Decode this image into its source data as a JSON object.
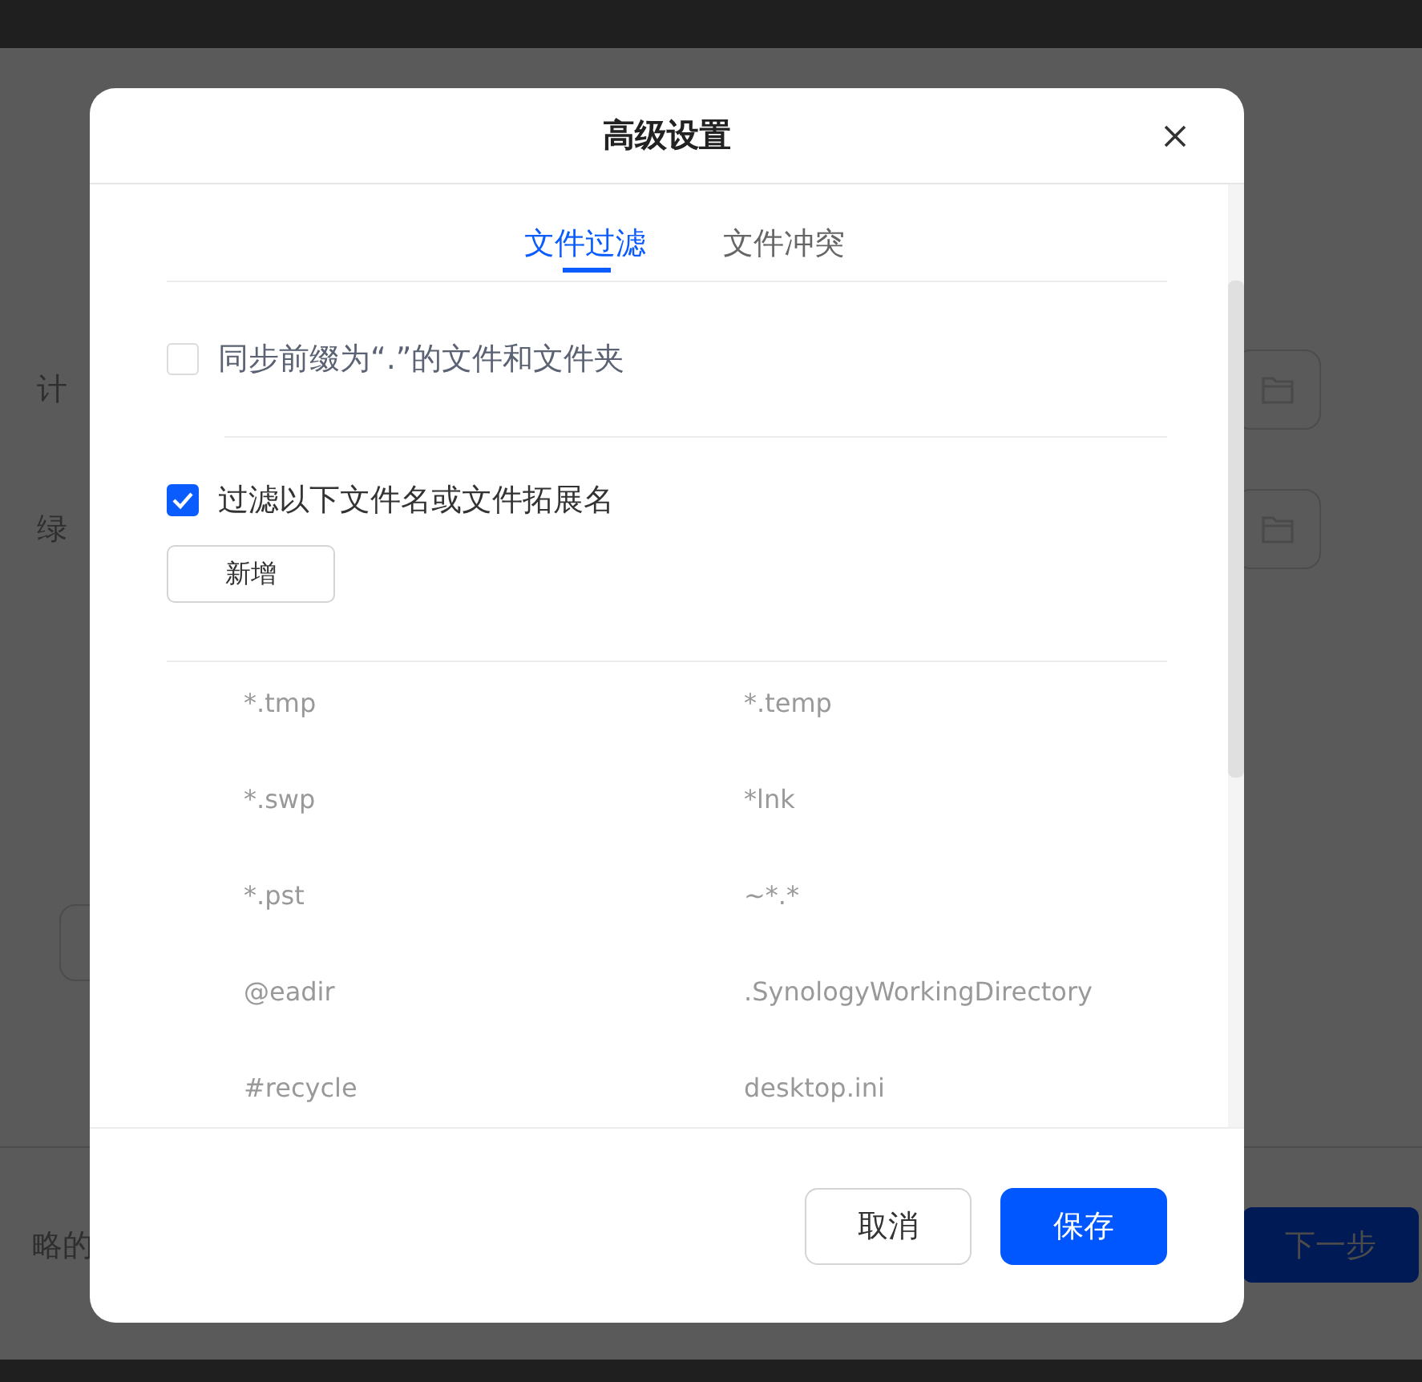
{
  "background_dialog": {
    "fields": [
      {
        "label": "计"
      },
      {
        "label": "绿"
      }
    ],
    "footer_text": "略的",
    "next_button": "下一步"
  },
  "dialog": {
    "title": "高级设置",
    "tabs": [
      {
        "label": "文件过滤",
        "selected": true
      },
      {
        "label": "文件冲突",
        "selected": false
      }
    ],
    "options": [
      {
        "label": "同步前缀为“.”的文件和文件夹",
        "checked": false
      },
      {
        "label": "过滤以下文件名或文件拓展名",
        "checked": true
      }
    ],
    "add_button": "新增",
    "patterns": [
      "*.tmp",
      "*.temp",
      "*.swp",
      "*lnk",
      "*.pst",
      "~*.*",
      "@eadir",
      ".SynologyWorkingDirectory",
      "#recycle",
      "desktop.ini"
    ],
    "buttons": [
      {
        "label": "取消",
        "kind": "secondary"
      },
      {
        "label": "保存",
        "kind": "primary"
      }
    ]
  }
}
